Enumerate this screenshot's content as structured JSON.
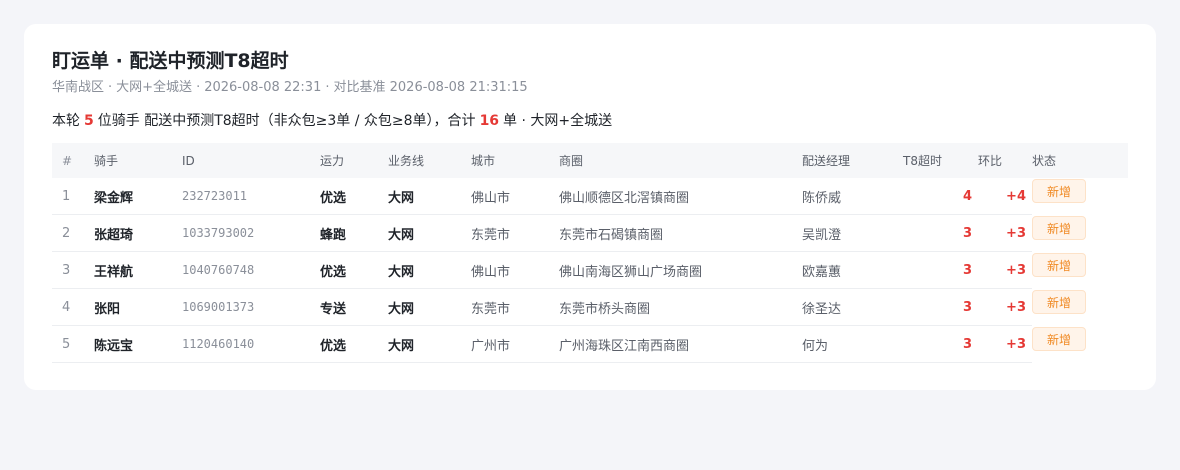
{
  "header": {
    "title": "盯运单 · 配送中预测T8超时",
    "subtitle_region": "华南战区",
    "subtitle_scope": "大网+全城送",
    "subtitle_time": "2026-08-08 22:31",
    "subtitle_baseline": "对比基准 2026-08-08 21:31:15",
    "separator": "·"
  },
  "summary": {
    "prefix": "本轮",
    "rider_count": "5",
    "middle": "位骑手 配送中预测T8超时（非众包≥3单 / 众包≥8单），合计",
    "order_count": "16",
    "suffix": "单 · 大网+全城送"
  },
  "table": {
    "headers": {
      "idx": "#",
      "rider": "骑手",
      "id": "ID",
      "capacity": "运力",
      "line": "业务线",
      "city": "城市",
      "zone": "商圈",
      "manager": "配送经理",
      "t8": "T8超时",
      "compare": "环比",
      "status": "状态"
    },
    "rows": [
      {
        "idx": "1",
        "rider": "梁金辉",
        "id": "232723011",
        "capacity": "优选",
        "line": "大网",
        "city": "佛山市",
        "zone": "佛山顺德区北滘镇商圈",
        "manager": "陈侨威",
        "t8": "4",
        "compare": "+4",
        "status": "新增"
      },
      {
        "idx": "2",
        "rider": "张超琦",
        "id": "1033793002",
        "capacity": "蜂跑",
        "line": "大网",
        "city": "东莞市",
        "zone": "东莞市石碣镇商圈",
        "manager": "吴凯澄",
        "t8": "3",
        "compare": "+3",
        "status": "新增"
      },
      {
        "idx": "3",
        "rider": "王祥航",
        "id": "1040760748",
        "capacity": "优选",
        "line": "大网",
        "city": "佛山市",
        "zone": "佛山南海区狮山广场商圈",
        "manager": "欧嘉蕙",
        "t8": "3",
        "compare": "+3",
        "status": "新增"
      },
      {
        "idx": "4",
        "rider": "张阳",
        "id": "1069001373",
        "capacity": "专送",
        "line": "大网",
        "city": "东莞市",
        "zone": "东莞市桥头商圈",
        "manager": "徐圣达",
        "t8": "3",
        "compare": "+3",
        "status": "新增"
      },
      {
        "idx": "5",
        "rider": "陈远宝",
        "id": "1120460140",
        "capacity": "优选",
        "line": "大网",
        "city": "广州市",
        "zone": "广州海珠区江南西商圈",
        "manager": "何为",
        "t8": "3",
        "compare": "+3",
        "status": "新增"
      }
    ]
  },
  "colors": {
    "accent_red": "#e53935",
    "badge_orange": "#f08a24",
    "badge_bg": "#fff4ea"
  }
}
